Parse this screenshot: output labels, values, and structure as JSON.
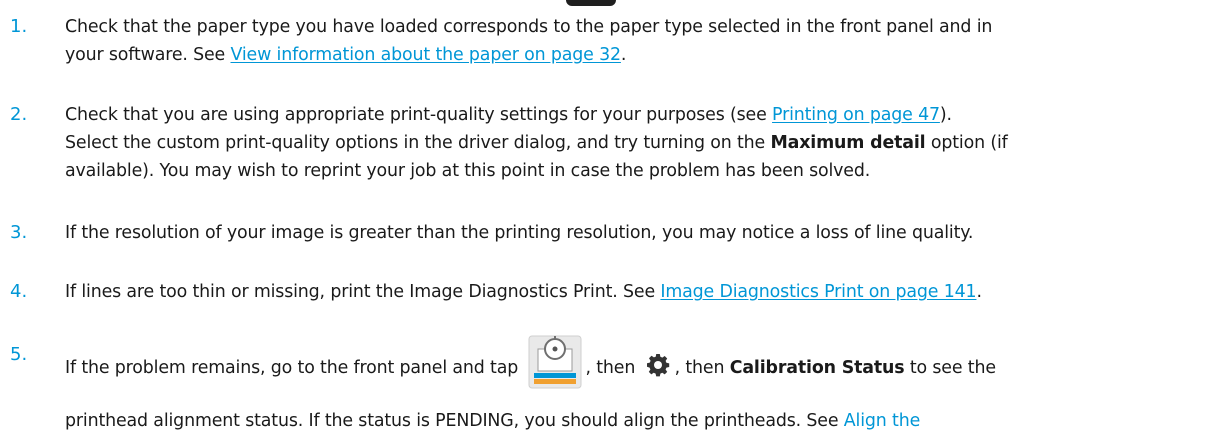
{
  "items": [
    {
      "num": "1.",
      "line1": "Check that the paper type you have loaded corresponds to the paper type selected in the front panel and in",
      "line2_prefix": "your software. See ",
      "line2_link": "View information about the paper on page 32",
      "line2_suffix": "."
    },
    {
      "num": "2.",
      "line1_prefix": "Check that you are using appropriate print-quality settings for your purposes (see ",
      "line1_link": "Printing on page 47",
      "line1_suffix": ").",
      "line2_prefix": "Select the custom print-quality options in the driver dialog, and try turning on the ",
      "line2_bold": "Maximum detail",
      "line2_suffix": " option (if",
      "line3": "available). You may wish to reprint your job at this point in case the problem has been solved."
    },
    {
      "num": "3.",
      "line1": "If the resolution of your image is greater than the printing resolution, you may notice a loss of line quality."
    },
    {
      "num": "4.",
      "line1_prefix": "If lines are too thin or missing, print the Image Diagnostics Print. See ",
      "line1_link": "Image Diagnostics Print on page 141",
      "line1_suffix": "."
    },
    {
      "num": "5.",
      "line1_prefix": "If the problem remains, go to the front panel and tap ",
      "line1_mid1": ", then ",
      "line1_mid2": ", then ",
      "line1_bold": "Calibration Status",
      "line1_suffix": " to see the",
      "line2_prefix": "printhead alignment status. If the status is PENDING, you should align the printheads. See ",
      "line2_link": "Align the"
    }
  ],
  "icons": {
    "panel_icon": "image-quality-panel-icon",
    "gear_icon": "settings-gear-icon"
  },
  "colors": {
    "accent": "#0096d6",
    "text": "#1a1a1a"
  }
}
